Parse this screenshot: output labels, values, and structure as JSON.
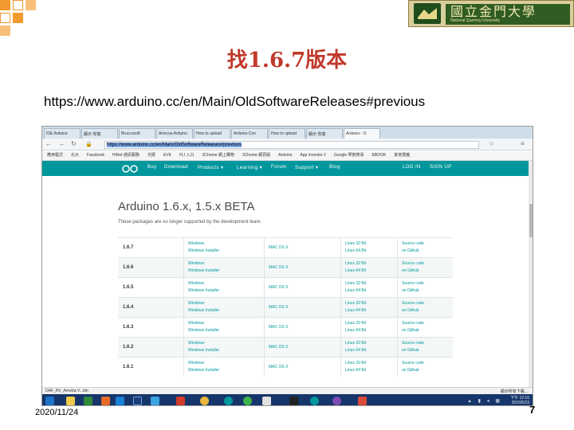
{
  "slide": {
    "title": "找1.6.7版本",
    "url_text": "https://www.arduino.cc/en/Main/OldSoftwareReleases#previous",
    "date": "2020/11/24",
    "page_number": "7",
    "logo_text": "國立金門大學",
    "logo_subtext": "National Quemoy University",
    "colors": {
      "title": "#c0392b",
      "decoration_orange": "#f29a2e"
    }
  },
  "browser": {
    "tabs": [
      "IDE Arduino",
      "顯示 恢復",
      "Bruccosoft",
      "Arrecoa Arduino",
      "How to upload",
      "Arduino-Con",
      "How to upload",
      "顯示 恢復",
      "Arduino - O"
    ],
    "active_tab_index": 8,
    "address": "https://www.arduino.cc/en/Main/OldSoftwareReleases#previous",
    "bookmarks": [
      "應用程式",
      "北大",
      "Facebook",
      "HiNet 通訊服務",
      "光碟",
      "EVE",
      "FLI 入口",
      "3Chome 網上購物",
      "3Chome 網頁版",
      "Arduino",
      "App Inventor 2",
      "Google 學術搜尋",
      "EBOOK",
      "其他書籤"
    ]
  },
  "site": {
    "nav": [
      "Buy",
      "Download",
      "Products ▾",
      "Learning ▾",
      "Forum",
      "Support ▾",
      "Blog"
    ],
    "login": "LOG IN",
    "signup": "SIGN UP",
    "heading": "Arduino 1.6.x, 1.5.x BETA",
    "description": "These packages are no longer supported by the development team.",
    "releases": [
      {
        "version": "1.6.7",
        "win": "Windows",
        "win2": "Windows Installer",
        "mac": "MAC OS X",
        "lin": "Linux 32 Bit",
        "lin2": "Linux 64 Bit",
        "src": "Source code",
        "src2": "on Github"
      },
      {
        "version": "1.6.6",
        "win": "Windows",
        "win2": "Windows Installer",
        "mac": "MAC OS X",
        "lin": "Linux 32 Bit",
        "lin2": "Linux 64 Bit",
        "src": "Source code",
        "src2": "on Github"
      },
      {
        "version": "1.6.5",
        "win": "Windows",
        "win2": "Windows Installer",
        "mac": "MAC OS X",
        "lin": "Linux 32 Bit",
        "lin2": "Linux 64 Bit",
        "src": "Source code",
        "src2": "on Github"
      },
      {
        "version": "1.6.4",
        "win": "Windows",
        "win2": "Windows Installer",
        "mac": "MAC OS X",
        "lin": "Linux 32 Bit",
        "lin2": "Linux 64 Bit",
        "src": "Source code",
        "src2": "on Github"
      },
      {
        "version": "1.6.3",
        "win": "Windows",
        "win2": "Windows Installer",
        "mac": "MAC OS X",
        "lin": "Linux 32 Bit",
        "lin2": "Linux 64 Bit",
        "src": "Source code",
        "src2": "on Github"
      },
      {
        "version": "1.6.2",
        "win": "Windows",
        "win2": "Windows Installer",
        "mac": "MAC OS X",
        "lin": "Linux 32 Bit",
        "lin2": "Linux 64 Bit",
        "src": "Source code",
        "src2": "on Github"
      },
      {
        "version": "1.6.1",
        "win": "Windows",
        "win2": "Windows Installer",
        "mac": "MAC OS X",
        "lin": "Linux 32 Bit",
        "lin2": "Linux 64 Bit",
        "src": "Source code",
        "src2": "on Github"
      }
    ],
    "colors": {
      "teal": "#00979c"
    }
  },
  "downloads": {
    "item": "DAF_RV_Arneba V...bin",
    "show_all": "顯示所有下載..."
  },
  "taskbar": {
    "time": "下午 12:16",
    "date": "2016/5/23"
  }
}
